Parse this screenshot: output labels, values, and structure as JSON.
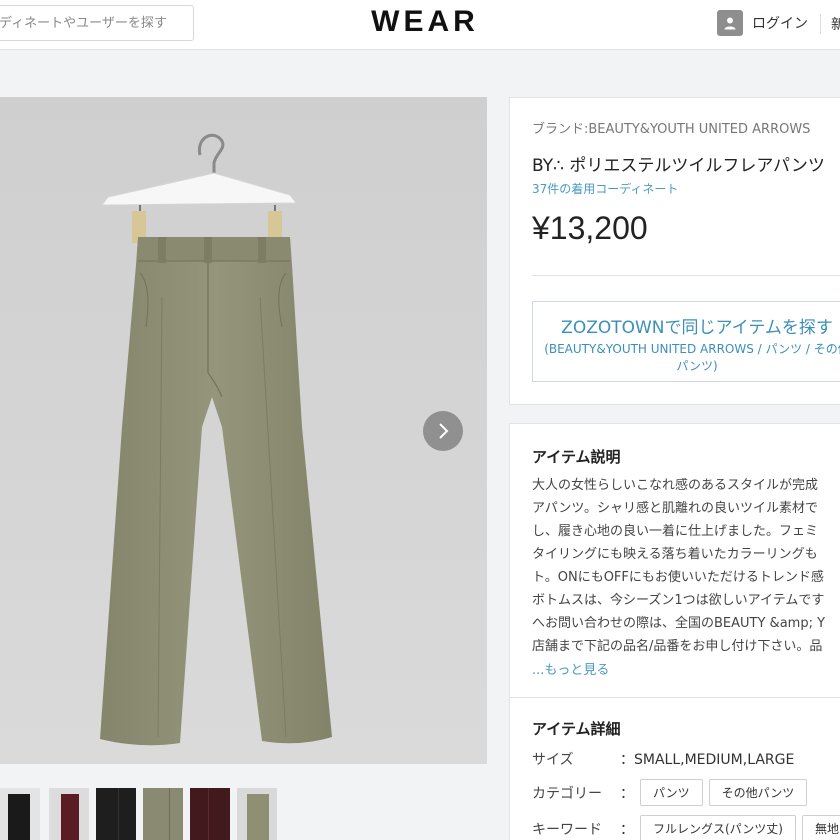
{
  "header": {
    "search_placeholder": "ディネートやユーザーを探す",
    "logo": "WEAR",
    "login_label": "ログイン",
    "cut_text": "新"
  },
  "product": {
    "brand": "ブランド:BEAUTY&YOUTH UNITED ARROWS",
    "title": "BY∴ ポリエステルツイルフレアパンツ",
    "coordinate_link": "37件の着用コーディネート",
    "price": "¥13,200",
    "zozo_button": {
      "main": "ZOZOTOWNで同じアイテムを探す",
      "sub": "(BEAUTY&YOUTH UNITED ARROWS / パンツ / その他パンツ)"
    }
  },
  "description": {
    "title": "アイテム説明",
    "lines": [
      "大人の女性らしいこなれ感のあるスタイルが完成",
      "アパンツ。シャリ感と肌離れの良いツイル素材で",
      "し、履き心地の良い一着に仕上げました。フェミ",
      "タイリングにも映える落ち着いたカラーリングも",
      "ト。ONにもOFFにもお使いいただけるトレンド感",
      "ボトムスは、今シーズン1つは欲しいアイテムです",
      "へお問い合わせの際は、全国のBEAUTY &amp; Y",
      "店舗まで下記の品名/品番をお申し付け下さい。品"
    ],
    "more_link": "...もっと見る"
  },
  "details": {
    "title": "アイテム詳細",
    "size_label": "サイズ",
    "size_value": "：SMALL,MEDIUM,LARGE",
    "category_label": "カテゴリー",
    "category_colon": "：",
    "category_tags": [
      "パンツ",
      "その他パンツ"
    ],
    "keyword_label": "キーワード",
    "keyword_colon": "：",
    "keyword_tags": [
      "フルレングス(パンツ丈)",
      "無地(柄)"
    ]
  },
  "colors": {
    "accent": "#3b8fba",
    "link": "#4a9bc2",
    "pants": "#8f8f74",
    "photo_bg": "#d1d1d1"
  },
  "icons": {
    "avatar": "user-icon",
    "next": "chevron-right-icon"
  }
}
